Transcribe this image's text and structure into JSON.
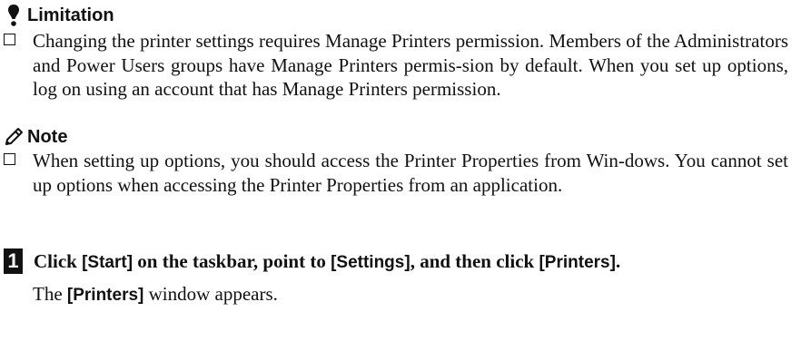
{
  "limitation": {
    "heading": "Limitation",
    "items": [
      "Changing the printer settings requires Manage Printers permission. Members of the Administrators and Power Users groups have Manage Printers permis-sion by default. When you set up options, log on using an account that has Manage Printers permission."
    ]
  },
  "note": {
    "heading": "Note",
    "items": [
      "When setting up options, you should access the Printer Properties from Win-dows. You cannot set up options when accessing the Printer Properties from an application."
    ]
  },
  "step1": {
    "number": "1",
    "parts": [
      "Click ",
      "[Start]",
      " on the taskbar, point to ",
      "[Settings]",
      ", and then click ",
      "[Printers]",
      "."
    ],
    "result_key": "[Printers]",
    "result_text": " window appears.",
    "result_prefix": "The "
  }
}
